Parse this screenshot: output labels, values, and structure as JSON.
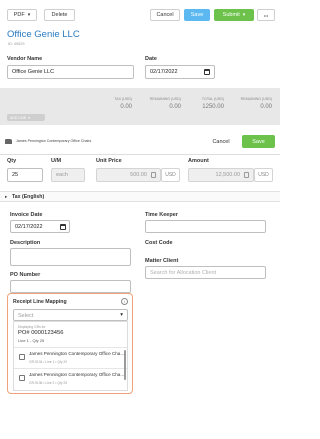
{
  "toolbar": {
    "pdf_label": "PDF",
    "delete_label": "Delete",
    "cancel_label": "Cancel",
    "save_label": "Save",
    "submit_label": "Submit",
    "more_label": "•••"
  },
  "header": {
    "title": "Office Genie LLC",
    "subtitle": "ID: 49029"
  },
  "form": {
    "vendor_name_label": "Vendor Name",
    "vendor_name_value": "Office Genie LLC",
    "date_label": "Date",
    "date_value": "02/17/2022"
  },
  "totals": {
    "columns": [
      {
        "header": "TAX (USD)",
        "value": "0.00"
      },
      {
        "header": "REMAINING (USD)",
        "value": "0.00"
      },
      {
        "header": "TOTAL (USD)",
        "value": "1250.00"
      },
      {
        "header": "REMAINING (USD)",
        "value": "0.00"
      }
    ],
    "add_line_label": "ADD LINE"
  },
  "line": {
    "description": "James Pennington Contemporary Office Chairs",
    "cancel_label": "Cancel",
    "save_label": "Save",
    "qty_label": "Qty",
    "qty_value": "25",
    "uom_label": "U/M",
    "uom_value": "each",
    "unit_price_label": "Unit Price",
    "unit_price_value": "500.00",
    "currency": "USD",
    "amount_label": "Amount",
    "amount_value": "12,500.00",
    "amount_currency": "USD"
  },
  "tax_section": {
    "label": "Tax (English)"
  },
  "details": {
    "invoice_date_label": "Invoice Date",
    "invoice_date_value": "02/17/2022",
    "time_keeper_label": "Time Keeper",
    "description_label": "Description",
    "cost_code_label": "Cost Code",
    "matter_client_label": "Matter Client",
    "matter_client_placeholder": "Search for Allocation Client",
    "po_number_label": "PO Number"
  },
  "mapping": {
    "label": "Receipt Line Mapping",
    "select_placeholder": "Select",
    "context_label": "Displaying GRs for",
    "po": "PO# 0000123456",
    "po_line": "Line 1 - Qty 25",
    "options": [
      {
        "title": "James Pennington Contemporary Office Cha...",
        "sub": "GR-9134 • Line 1 • Qty 20"
      },
      {
        "title": "James Pennington Contemporary Office Cha...",
        "sub": "GR-9136 • Line 2 • Qty 25"
      }
    ]
  },
  "colors": {
    "accent_blue": "#5bb8f0",
    "accent_green": "#6cc24a",
    "title_blue": "#2a7bc0",
    "highlight_orange": "#f0a27a"
  }
}
